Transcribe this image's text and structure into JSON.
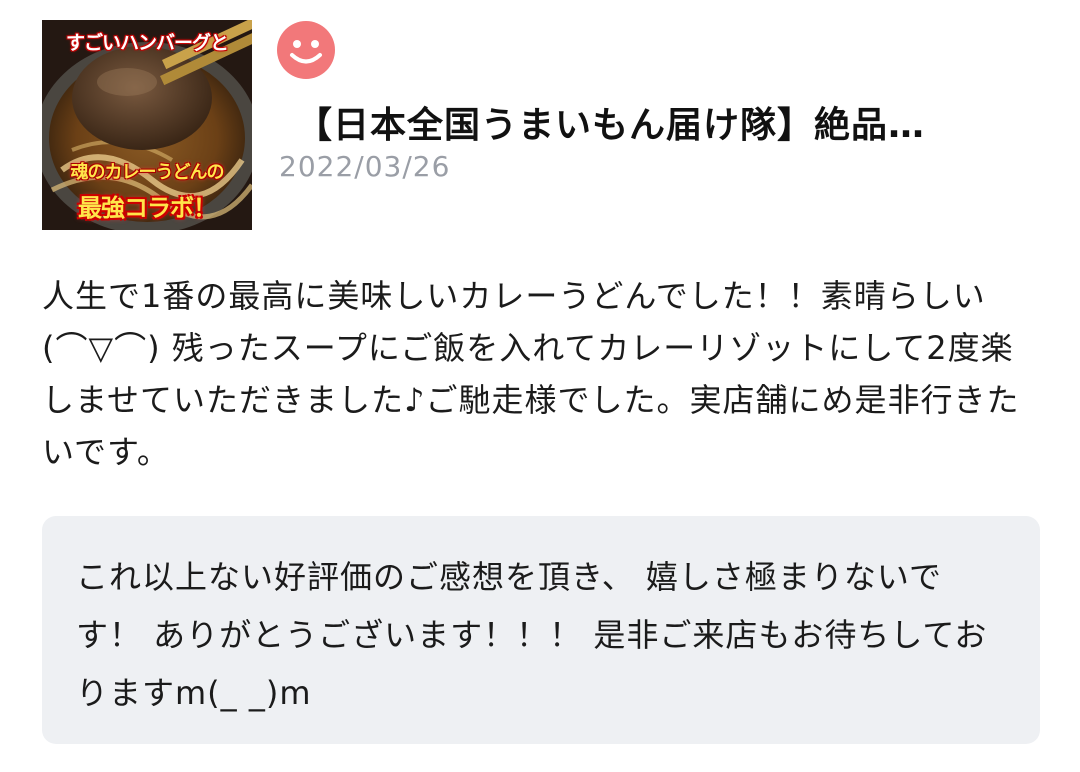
{
  "review": {
    "thumbnail": {
      "caption_top": "すごいハンバーグと",
      "caption_mid": "魂のカレーうどんの",
      "caption_bottom": "最強コラボ！"
    },
    "rating_icon": "smiley-face-icon",
    "rating_color": "#f2787a",
    "product_title": "【日本全国うまいもん届け隊】絶品…",
    "date": "2022/03/26",
    "body": "人生で1番の最高に美味しいカレーうどんでした！！素晴らしい(⌒▽⌒) 残ったスープにご飯を入れてカレーリゾットにして2度楽しませていただきました♪ご馳走様でした。実店舗にめ是非行きたいです。"
  },
  "reply": {
    "text": "これ以上ない好評価のご感想を頂き、 嬉しさ極まりないです！ ありがとうございます！！！ 是非ご来店もお待ちしておりますm(_ _)m",
    "background_color": "#eef0f3"
  }
}
